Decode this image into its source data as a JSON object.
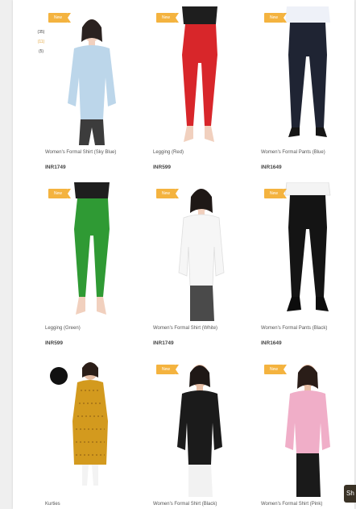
{
  "filters": {
    "counts": [
      "(35)",
      "(11)",
      "(5)"
    ]
  },
  "badge_label": "New",
  "products": [
    {
      "title": "Women's Formal Shirt (Sky Blue)",
      "price": "INR1749",
      "badge": true
    },
    {
      "title": "Legging (Red)",
      "price": "INR599",
      "badge": true
    },
    {
      "title": "Women's Formal Pants (Blue)",
      "price": "INR1649",
      "badge": true
    },
    {
      "title": "Legging (Green)",
      "price": "INR599",
      "badge": true
    },
    {
      "title": "Women's Formal Shirt (White)",
      "price": "INR1749",
      "badge": true
    },
    {
      "title": "Women's Formal Pants (Black)",
      "price": "INR1649",
      "badge": true
    },
    {
      "title": "Kurties",
      "price": "",
      "badge": false
    },
    {
      "title": "Women's Formal Shirt (Black)",
      "price": "",
      "badge": true
    },
    {
      "title": "Women's Formal Shirt (Pink)",
      "price": "",
      "badge": true
    }
  ],
  "chat_label": "Sh",
  "colors": {
    "badge": "#f4b33f",
    "filter_active": "#e2a33a",
    "chat_bg": "#3a3226"
  }
}
